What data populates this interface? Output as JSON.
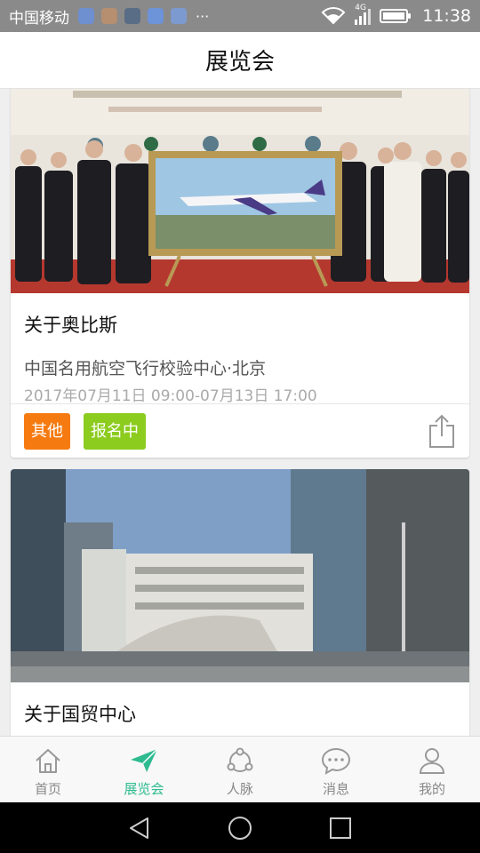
{
  "status_bar": {
    "carrier": "中国移动",
    "more": "···",
    "network": "4G",
    "time": "11:38"
  },
  "header": {
    "title": "展览会"
  },
  "cards": [
    {
      "title": "关于奥比斯",
      "venue": "中国名用航空飞行校验中心·北京",
      "time": "2017年07月11日 09:00-07月13日 17:00",
      "tags": [
        "其他",
        "报名中"
      ]
    },
    {
      "title": "关于国贸中心"
    }
  ],
  "tabs": [
    {
      "label": "首页",
      "icon": "home-icon"
    },
    {
      "label": "展览会",
      "icon": "paper-plane-icon"
    },
    {
      "label": "人脉",
      "icon": "network-icon"
    },
    {
      "label": "消息",
      "icon": "chat-bubble-icon"
    },
    {
      "label": "我的",
      "icon": "user-icon"
    }
  ],
  "colors": {
    "accent": "#2dbb8f",
    "tag_other": "#f57a10",
    "tag_status": "#8ccc1f"
  }
}
